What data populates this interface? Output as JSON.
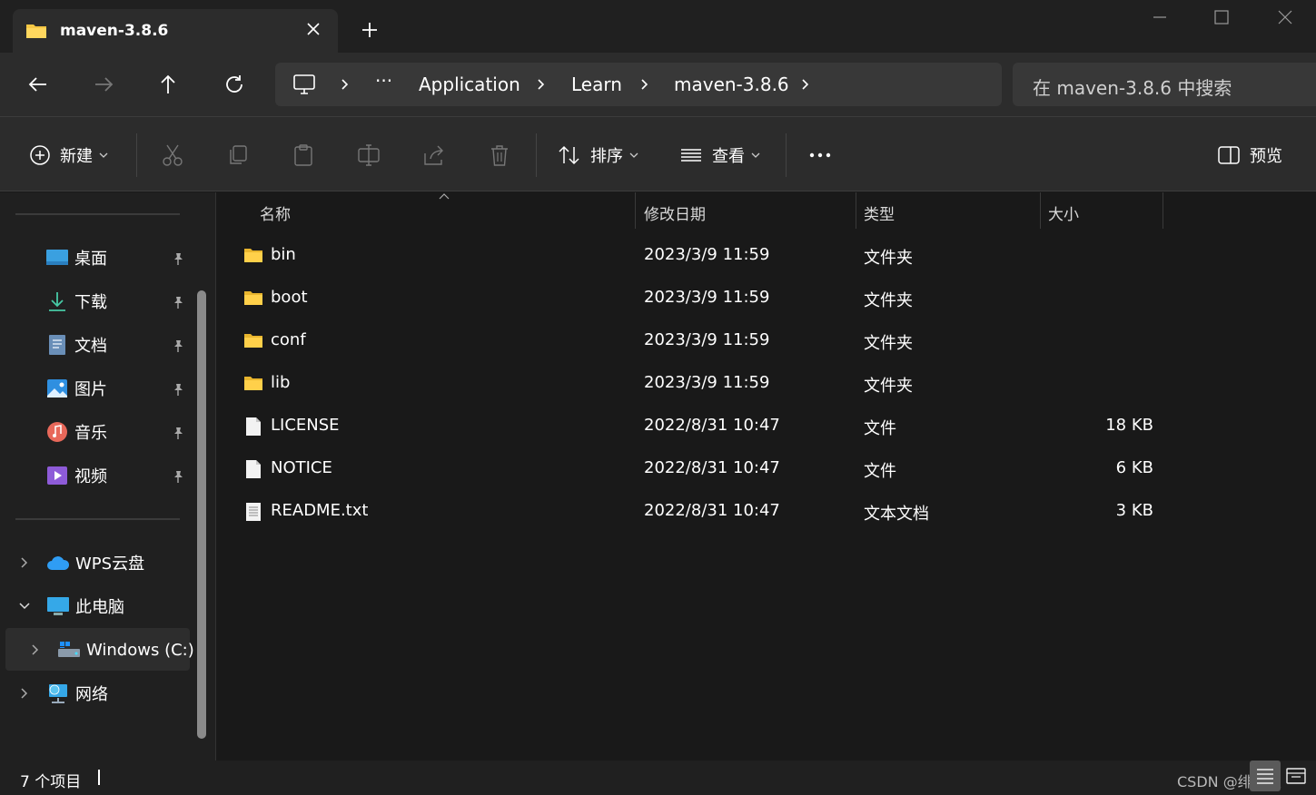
{
  "tab": {
    "title": "maven-3.8.6",
    "new_tab_label": "+"
  },
  "nav": {
    "breadcrumb": [
      "Application",
      "Learn",
      "maven-3.8.6"
    ],
    "overflow_label": "···"
  },
  "search": {
    "placeholder": "在 maven-3.8.6 中搜索"
  },
  "toolbar": {
    "new_label": "新建",
    "sort_label": "排序",
    "view_label": "查看",
    "more_label": "···",
    "preview_label": "预览"
  },
  "sidebar": {
    "quick_access": [
      {
        "label": "桌面",
        "icon": "desktop-icon"
      },
      {
        "label": "下载",
        "icon": "download-icon"
      },
      {
        "label": "文档",
        "icon": "document-icon"
      },
      {
        "label": "图片",
        "icon": "pictures-icon"
      },
      {
        "label": "音乐",
        "icon": "music-icon"
      },
      {
        "label": "视频",
        "icon": "video-icon"
      }
    ],
    "tree": [
      {
        "label": "WPS云盘",
        "icon": "cloud-icon"
      },
      {
        "label": "此电脑",
        "icon": "computer-icon"
      },
      {
        "label": "Windows (C:)",
        "icon": "drive-icon"
      },
      {
        "label": "网络",
        "icon": "network-icon"
      }
    ]
  },
  "columns": {
    "name": "名称",
    "modified": "修改日期",
    "type": "类型",
    "size": "大小"
  },
  "files": [
    {
      "name": "bin",
      "modified": "2023/3/9 11:59",
      "type": "文件夹",
      "size": "",
      "icon": "folder-icon"
    },
    {
      "name": "boot",
      "modified": "2023/3/9 11:59",
      "type": "文件夹",
      "size": "",
      "icon": "folder-icon"
    },
    {
      "name": "conf",
      "modified": "2023/3/9 11:59",
      "type": "文件夹",
      "size": "",
      "icon": "folder-icon"
    },
    {
      "name": "lib",
      "modified": "2023/3/9 11:59",
      "type": "文件夹",
      "size": "",
      "icon": "folder-icon"
    },
    {
      "name": "LICENSE",
      "modified": "2022/8/31 10:47",
      "type": "文件",
      "size": "18 KB",
      "icon": "file-icon"
    },
    {
      "name": "NOTICE",
      "modified": "2022/8/31 10:47",
      "type": "文件",
      "size": "6 KB",
      "icon": "file-icon"
    },
    {
      "name": "README.txt",
      "modified": "2022/8/31 10:47",
      "type": "文本文档",
      "size": "3 KB",
      "icon": "text-file-icon"
    }
  ],
  "status": {
    "item_count": "7 个项目",
    "watermark": "CSDN @绯雨玖"
  },
  "colors": {
    "folder": "#f6c744",
    "accent": "#4cc2ff",
    "sidebar_bg": "#202020",
    "toolbar_bg": "#2c2c2c"
  }
}
